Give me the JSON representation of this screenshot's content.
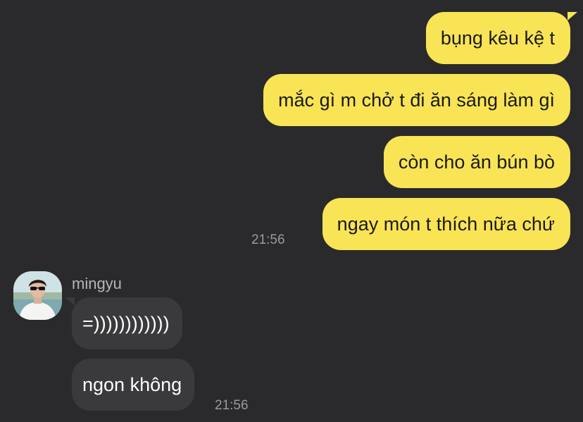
{
  "colors": {
    "background": "#2a2a2c",
    "outgoing_bubble": "#f9e455",
    "incoming_bubble": "#3a3a3c",
    "timestamp": "#9a9a9e"
  },
  "outgoing": {
    "messages": [
      {
        "text": "bụng kêu kệ t"
      },
      {
        "text": "mắc gì m chở t đi ăn sáng làm gì"
      },
      {
        "text": "còn cho ăn bún bò"
      },
      {
        "text": "ngay món t thích nữa chứ"
      }
    ],
    "time": "21:56"
  },
  "incoming": {
    "sender": "mingyu",
    "avatar_icon": "profile-photo",
    "messages": [
      {
        "text": "=))))))))))))"
      },
      {
        "text": "ngon không"
      }
    ],
    "time": "21:56"
  }
}
